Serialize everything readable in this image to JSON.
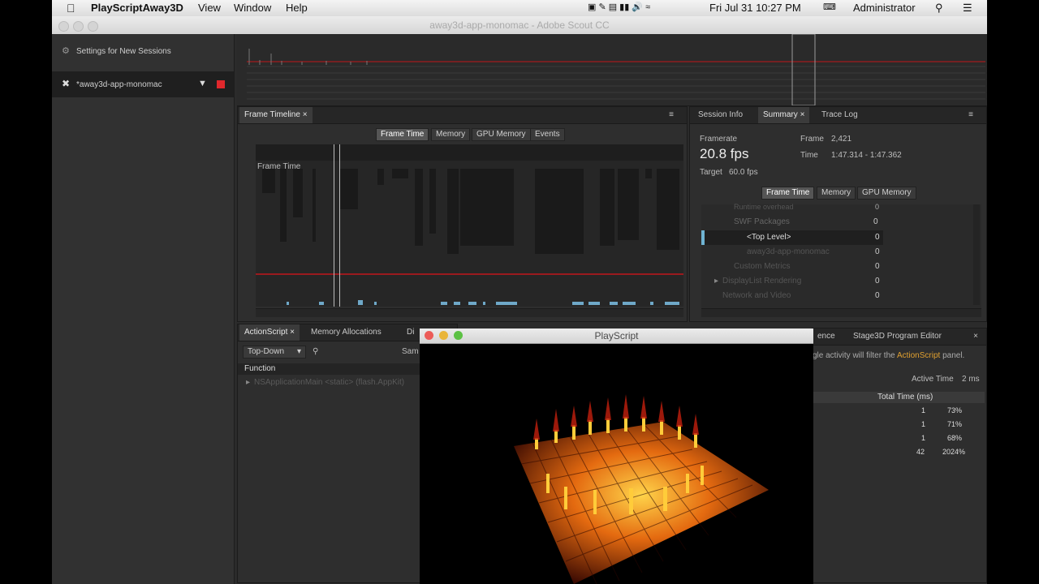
{
  "menubar": {
    "apple": "",
    "app_name": "PlayScriptAway3D",
    "items": [
      "View",
      "Window",
      "Help"
    ],
    "clock": "Fri Jul 31  10:27 PM",
    "user": "Administrator"
  },
  "window": {
    "title": "away3d-app-monomac - Adobe Scout CC"
  },
  "sidebar": {
    "settings_label": "Settings for New Sessions",
    "session_label": "*away3d-app-monomac"
  },
  "frame_timeline": {
    "tab": "Frame Timeline",
    "buttons": [
      "Frame Time",
      "Memory",
      "GPU Memory",
      "Events"
    ],
    "graph_label": "Frame Time"
  },
  "session_panel": {
    "tabs": [
      "Session Info",
      "Summary",
      "Trace Log"
    ],
    "framerate_label": "Framerate",
    "fps": "20.8 fps",
    "target_label": "Target",
    "target_value": "60.0 fps",
    "frame_label": "Frame",
    "frame_value": "2,421",
    "time_label": "Time",
    "time_value": "1:47.314 - 1:47.362",
    "buttons": [
      "Frame Time",
      "Memory",
      "GPU Memory"
    ],
    "rows": [
      {
        "name": "Runtime overhead",
        "value": "0"
      },
      {
        "name": "SWF Packages",
        "value": "0"
      },
      {
        "name": "<Top Level>",
        "value": "0"
      },
      {
        "name": "away3d-app-monomac",
        "value": "0"
      },
      {
        "name": "Custom Metrics",
        "value": "0"
      },
      {
        "name": "DisplayList Rendering",
        "value": "0"
      },
      {
        "name": "Network and Video",
        "value": "0"
      }
    ]
  },
  "actionscript_panel": {
    "tabs": [
      "ActionScript",
      "Memory Allocations",
      "Di"
    ],
    "dropdown": "Top-Down",
    "sample_label": "Sam",
    "column_function": "Function",
    "row1": "NSApplicationMain <static> (flash.AppKit)"
  },
  "right_bottom_panel": {
    "tabs": [
      "ence",
      "Stage3D Program Editor"
    ],
    "hint": "gle activity will filter the ",
    "hint_link": "ActionScript",
    "hint_end": " panel.",
    "active_time_label": "Active Time",
    "active_time_value": "2 ms",
    "column_total": "Total Time (ms)",
    "rows": [
      {
        "value": "1",
        "pct": "73%"
      },
      {
        "value": "1",
        "pct": "71%"
      },
      {
        "value": "1",
        "pct": "68%"
      },
      {
        "value": "42",
        "pct": "2024%"
      }
    ]
  },
  "game_window": {
    "title": "PlayScript"
  },
  "colors": {
    "accent_link": "#e0a030",
    "threshold_line": "#c0161b",
    "record_red": "#e0282c"
  }
}
